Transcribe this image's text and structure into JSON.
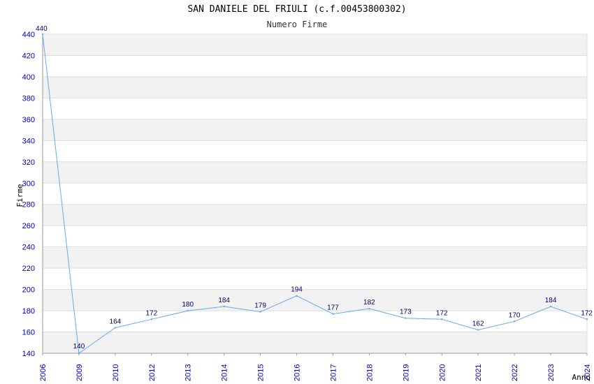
{
  "chart_data": {
    "type": "line",
    "title": "SAN DANIELE DEL FRIULI (c.f.00453800302)",
    "subtitle": "Numero Firme",
    "xlabel": "Anno",
    "ylabel": "Firme",
    "categories": [
      "2006",
      "2009",
      "2010",
      "2012",
      "2013",
      "2014",
      "2015",
      "2016",
      "2017",
      "2018",
      "2019",
      "2020",
      "2021",
      "2022",
      "2023",
      "2024"
    ],
    "series": [
      {
        "values": [
          440,
          140,
          164,
          172,
          180,
          184,
          179,
          194,
          177,
          182,
          173,
          172,
          162,
          170,
          184,
          172
        ]
      }
    ],
    "ylim": [
      140,
      440
    ],
    "yticks": [
      140,
      160,
      180,
      200,
      220,
      240,
      260,
      280,
      300,
      320,
      340,
      360,
      380,
      400,
      420,
      440
    ],
    "grid": true,
    "colors": {
      "line": "#66aaee",
      "tick": "#0000aa",
      "label": "#000066",
      "band": "#f2f2f2",
      "grid": "#dddddd"
    }
  }
}
